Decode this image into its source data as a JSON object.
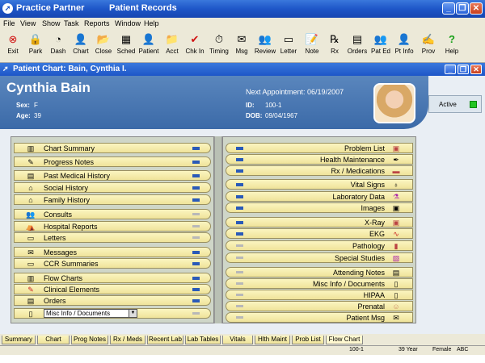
{
  "window": {
    "app_title": "Practice Partner",
    "module_title": "Patient Records"
  },
  "menu": [
    "File",
    "View",
    "Show",
    "Task",
    "Reports",
    "Window",
    "Help"
  ],
  "toolbar": [
    {
      "label": "Exit",
      "icon": "exit-icon"
    },
    {
      "label": "Park",
      "icon": "park-icon"
    },
    {
      "label": "Dash",
      "icon": "dashboard-icon"
    },
    {
      "label": "Chart",
      "icon": "chart-icon"
    },
    {
      "label": "Close",
      "icon": "close-chart-icon"
    },
    {
      "label": "Sched",
      "icon": "schedule-icon"
    },
    {
      "label": "Patient",
      "icon": "patient-icon"
    },
    {
      "label": "Acct",
      "icon": "account-icon"
    },
    {
      "label": "Chk In",
      "icon": "check-in-icon"
    },
    {
      "label": "Timing",
      "icon": "timing-icon"
    },
    {
      "label": "Msg",
      "icon": "message-icon"
    },
    {
      "label": "Review",
      "icon": "review-icon"
    },
    {
      "label": "Letter",
      "icon": "letter-icon"
    },
    {
      "label": "Note",
      "icon": "note-icon"
    },
    {
      "label": "Rx",
      "icon": "rx-icon"
    },
    {
      "label": "Orders",
      "icon": "orders-icon"
    },
    {
      "label": "Pat Ed",
      "icon": "patient-education-icon"
    },
    {
      "label": "Pt Info",
      "icon": "patient-info-icon"
    },
    {
      "label": "Prov",
      "icon": "provider-icon"
    },
    {
      "label": "Help",
      "icon": "help-icon"
    }
  ],
  "chart_window": {
    "title": "Patient Chart: Bain, Cynthia I."
  },
  "patient": {
    "name": "Cynthia Bain",
    "sex_label": "Sex:",
    "sex": "F",
    "age_label": "Age:",
    "age": "39",
    "next_appt": "Next Appointment: 06/19/2007",
    "id_label": "ID:",
    "id": "100-1",
    "dob_label": "DOB:",
    "dob": "09/04/1967",
    "status": "Active",
    "status_color": "#22c422"
  },
  "left_tabs": [
    {
      "label": "Chart Summary",
      "icon": "chart-summary-icon",
      "flag": "blue"
    },
    {
      "label": "Progress Notes",
      "icon": "progress-notes-icon",
      "flag": "blue"
    },
    {
      "label": "Past Medical History",
      "icon": "history-icon",
      "flag": "blue"
    },
    {
      "label": "Social History",
      "icon": "house-icon",
      "flag": "blue"
    },
    {
      "label": "Family History",
      "icon": "family-icon",
      "flag": "blue"
    },
    {
      "label": "Consults",
      "icon": "consults-icon",
      "flag": "gray"
    },
    {
      "label": "Hospital Reports",
      "icon": "hospital-bed-icon",
      "flag": "gray"
    },
    {
      "label": "Letters",
      "icon": "letter-icon",
      "flag": "gray"
    },
    {
      "label": "Messages",
      "icon": "messages-icon",
      "flag": "blue"
    },
    {
      "label": "CCR Summaries",
      "icon": "ccr-icon",
      "flag": "blue"
    },
    {
      "label": "Flow Charts",
      "icon": "flow-chart-icon",
      "flag": "blue"
    },
    {
      "label": "Clinical Elements",
      "icon": "clinical-elements-icon",
      "flag": "blue"
    },
    {
      "label": "Orders",
      "icon": "orders-icon",
      "flag": "blue"
    },
    {
      "label": "Misc Info / Documents",
      "icon": "document-icon",
      "flag": "gray"
    }
  ],
  "right_tabs": [
    {
      "label": "Problem List",
      "icon": "problem-list-icon",
      "flag": "blue"
    },
    {
      "label": "Health Maintenance",
      "icon": "syringe-icon",
      "flag": "blue"
    },
    {
      "label": "Rx / Medications",
      "icon": "medications-icon",
      "flag": "blue"
    },
    {
      "label": "Vital Signs",
      "icon": "stethoscope-icon",
      "flag": "blue"
    },
    {
      "label": "Laboratory Data",
      "icon": "lab-icon",
      "flag": "blue"
    },
    {
      "label": "Images",
      "icon": "images-icon",
      "flag": "blue"
    },
    {
      "label": "X-Ray",
      "icon": "xray-icon",
      "flag": "blue"
    },
    {
      "label": "EKG",
      "icon": "ekg-icon",
      "flag": "blue"
    },
    {
      "label": "Pathology",
      "icon": "pathology-icon",
      "flag": "gray"
    },
    {
      "label": "Special Studies",
      "icon": "special-studies-icon",
      "flag": "gray"
    },
    {
      "label": "Attending Notes",
      "icon": "notes-icon",
      "flag": "gray"
    },
    {
      "label": "Misc Info / Documents",
      "icon": "document-icon",
      "flag": "gray"
    },
    {
      "label": "HIPAA",
      "icon": "hipaa-icon",
      "flag": "gray"
    },
    {
      "label": "Prenatal",
      "icon": "prenatal-icon",
      "flag": "gray"
    },
    {
      "label": "Patient Msg",
      "icon": "patient-msg-icon",
      "flag": "gray"
    }
  ],
  "bottom_tabs": [
    "Summary",
    "Chart",
    "Prog Notes",
    "Rx / Meds",
    "Recent Lab",
    "Lab Tables",
    "Vitals",
    "Hlth Maint",
    "Prob List",
    "Flow Chart"
  ],
  "statusbar": {
    "id": "100-1",
    "age": "39 Year",
    "sex": "Female",
    "code": "ABC"
  }
}
